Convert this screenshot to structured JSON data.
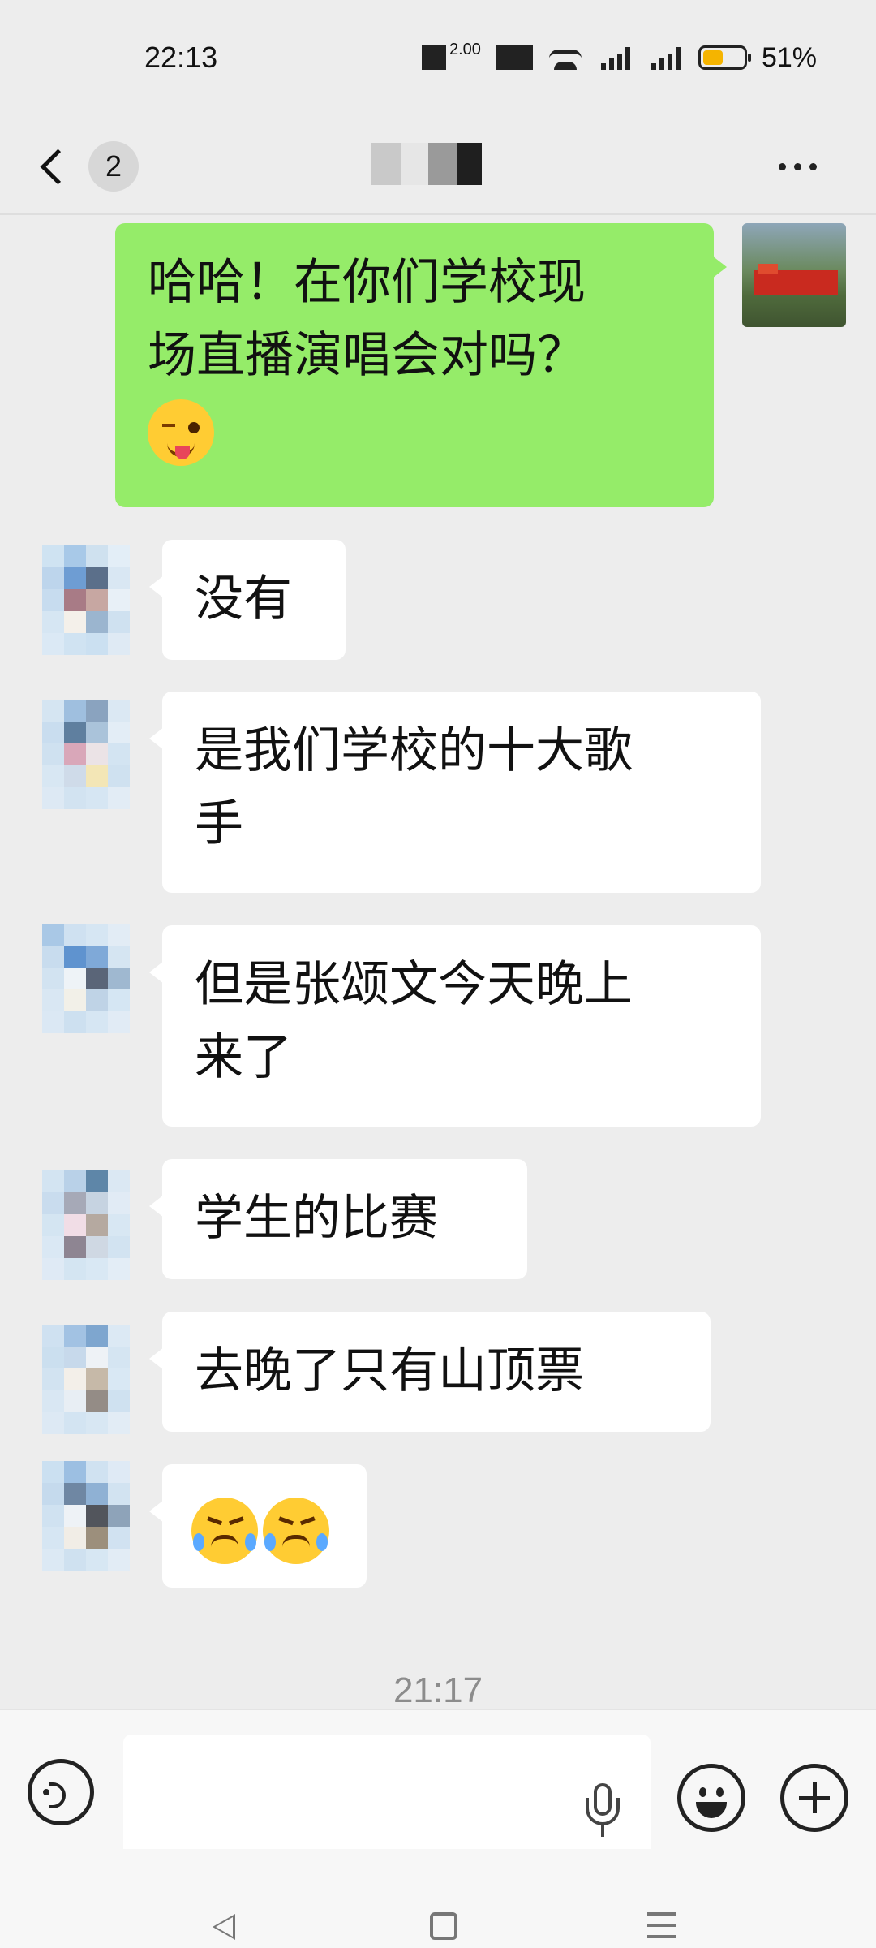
{
  "status_bar": {
    "time": "22:13",
    "speed": "2.00",
    "battery_text": "51%",
    "battery_level": 0.51,
    "battery_color": "#f5b400"
  },
  "header": {
    "unread_count": "2",
    "title_hidden": "pixelated contact name",
    "more_icon": "more-icon"
  },
  "self_message": {
    "text": "哈哈！在你们学校现\n场直播演唱会对吗？",
    "emoji": "wink-tongue-emoji",
    "bubble_color": "#95ec69"
  },
  "incoming_messages": [
    {
      "text": "没有"
    },
    {
      "text": "是我们学校的十大歌\n手"
    },
    {
      "text": "但是张颂文今天晚上\n来了"
    },
    {
      "text": "学生的比赛"
    },
    {
      "text": "去晚了只有山顶票"
    },
    {
      "text": "",
      "emoji": [
        "crying-emoji",
        "crying-emoji"
      ]
    }
  ],
  "timestamp": "21:17",
  "input_bar": {
    "placeholder": "",
    "voice_icon": "voice-icon",
    "mic_icon": "mic-icon",
    "emoji_icon": "emoji-icon",
    "plus_icon": "plus-icon"
  },
  "nav_bar": {
    "back_icon": "nav-back-icon",
    "home_icon": "nav-home-icon",
    "recent_icon": "nav-recent-icon"
  }
}
